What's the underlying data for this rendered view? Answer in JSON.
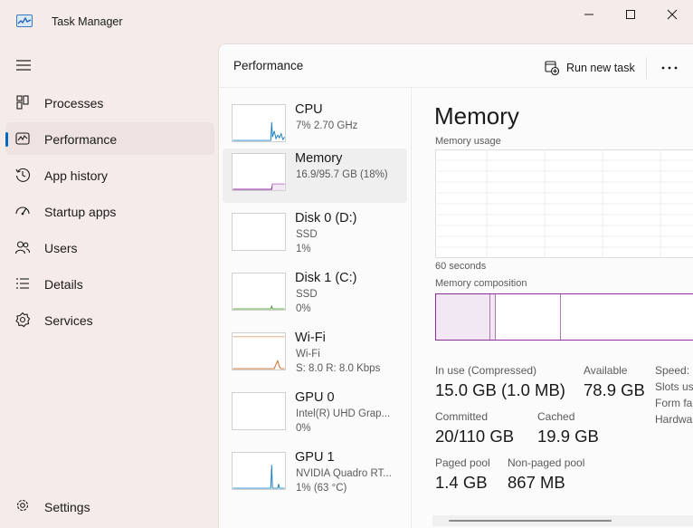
{
  "window": {
    "title": "Task Manager"
  },
  "nav": {
    "items": [
      {
        "label": "Processes",
        "icon": "processes-icon"
      },
      {
        "label": "Performance",
        "icon": "performance-icon",
        "active": true
      },
      {
        "label": "App history",
        "icon": "history-icon"
      },
      {
        "label": "Startup apps",
        "icon": "startup-icon"
      },
      {
        "label": "Users",
        "icon": "users-icon"
      },
      {
        "label": "Details",
        "icon": "details-icon"
      },
      {
        "label": "Services",
        "icon": "services-icon"
      }
    ],
    "settings_label": "Settings"
  },
  "header": {
    "title": "Performance",
    "run_task_label": "Run new task"
  },
  "perf_list": [
    {
      "name": "CPU",
      "l2": "7% 2.70 GHz",
      "l3": ""
    },
    {
      "name": "Memory",
      "l2": "16.9/95.7 GB (18%)",
      "l3": ""
    },
    {
      "name": "Disk 0 (D:)",
      "l2": "SSD",
      "l3": "1%"
    },
    {
      "name": "Disk 1 (C:)",
      "l2": "SSD",
      "l3": "0%"
    },
    {
      "name": "Wi-Fi",
      "l2": "Wi-Fi",
      "l3": "S: 8.0 R: 8.0 Kbps"
    },
    {
      "name": "GPU 0",
      "l2": "Intel(R) UHD Grap...",
      "l3": "0%"
    },
    {
      "name": "GPU 1",
      "l2": "NVIDIA Quadro RT...",
      "l3": "1% (63 °C)"
    }
  ],
  "detail": {
    "title": "Memory",
    "usage_label": "Memory usage",
    "time_label": "60 seconds",
    "composition_label": "Memory composition",
    "stats": {
      "in_use_label": "In use (Compressed)",
      "in_use_value": "15.0 GB (1.0 MB)",
      "available_label": "Available",
      "available_value": "78.9 GB",
      "committed_label": "Committed",
      "committed_value": "20/110 GB",
      "cached_label": "Cached",
      "cached_value": "19.9 GB",
      "paged_label": "Paged pool",
      "paged_value": "1.4 GB",
      "nonpaged_label": "Non-paged pool",
      "nonpaged_value": "867 MB"
    },
    "side_labels": [
      "Speed:",
      "Slots use",
      "Form fa",
      "Hardwa"
    ]
  },
  "colors": {
    "accent": "#0067c0",
    "memory": "#8c2d9c",
    "cpu": "#1a7fc4",
    "wifi": "#c8641e"
  }
}
